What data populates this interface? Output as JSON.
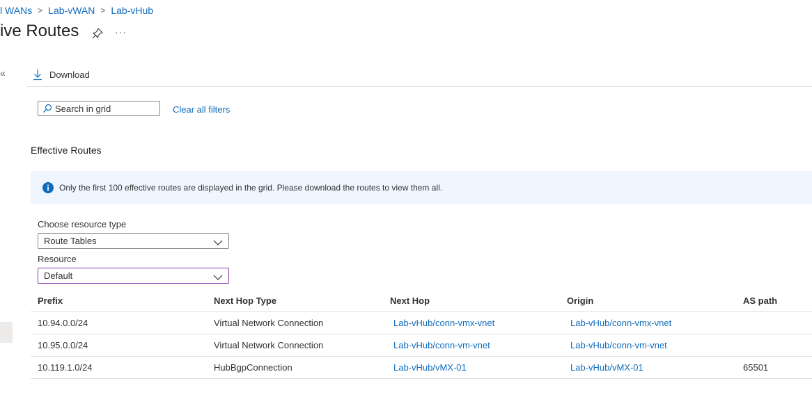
{
  "breadcrumb": {
    "items": [
      "l WANs",
      "Lab-vWAN",
      "Lab-vHub"
    ],
    "separator": ">"
  },
  "page": {
    "title": "ive Routes",
    "more_label": "···",
    "collapse_label": "«"
  },
  "toolbar": {
    "download_label": "Download"
  },
  "search": {
    "placeholder": "Search in grid",
    "value": ""
  },
  "filters": {
    "clear_all_label": "Clear all filters"
  },
  "section": {
    "title": "Effective Routes"
  },
  "banner": {
    "text": "Only the first 100 effective routes are displayed in the grid. Please download the routes to view them all."
  },
  "fields": {
    "resource_type": {
      "label": "Choose resource type",
      "value": "Route Tables"
    },
    "resource": {
      "label": "Resource",
      "value": "Default"
    }
  },
  "table": {
    "columns": [
      "Prefix",
      "Next Hop Type",
      "Next Hop",
      "Origin",
      "AS path"
    ],
    "rows": [
      [
        "10.94.0.0/24",
        "Virtual Network Connection",
        "Lab-vHub/conn-vmx-vnet",
        "Lab-vHub/conn-vmx-vnet",
        ""
      ],
      [
        "10.95.0.0/24",
        "Virtual Network Connection",
        "Lab-vHub/conn-vm-vnet",
        "Lab-vHub/conn-vm-vnet",
        ""
      ],
      [
        "10.119.1.0/24",
        "HubBgpConnection",
        "Lab-vHub/vMX-01",
        "Lab-vHub/vMX-01",
        "65501"
      ]
    ]
  },
  "colors": {
    "link": "#0f6cbd",
    "banner_bg": "#f0f6ff",
    "info_icon": "#0f6cbd",
    "focus_border": "#8a3aa8"
  }
}
